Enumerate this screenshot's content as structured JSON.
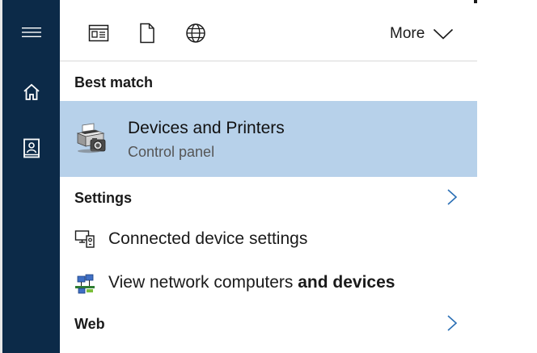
{
  "nav_rail": {
    "items": [
      {
        "icon": "hamburger-menu-icon"
      },
      {
        "icon": "home-icon"
      },
      {
        "icon": "notebook-icon"
      }
    ],
    "background": "#0c2a48"
  },
  "filters": {
    "icons": [
      "apps-icon",
      "documents-icon",
      "web-icon"
    ],
    "more_label": "More"
  },
  "best_match": {
    "heading": "Best match",
    "title": "Devices and Printers",
    "subtitle": "Control panel",
    "icon": "devices-and-printers-icon",
    "highlight": "#b7d1ea"
  },
  "settings": {
    "heading": "Settings",
    "items": [
      {
        "icon": "connected-devices-icon",
        "label": "Connected device settings"
      },
      {
        "icon": "network-computers-icon",
        "label_plain": "View network computers ",
        "label_bold": "and devices"
      }
    ]
  },
  "web": {
    "heading": "Web"
  }
}
